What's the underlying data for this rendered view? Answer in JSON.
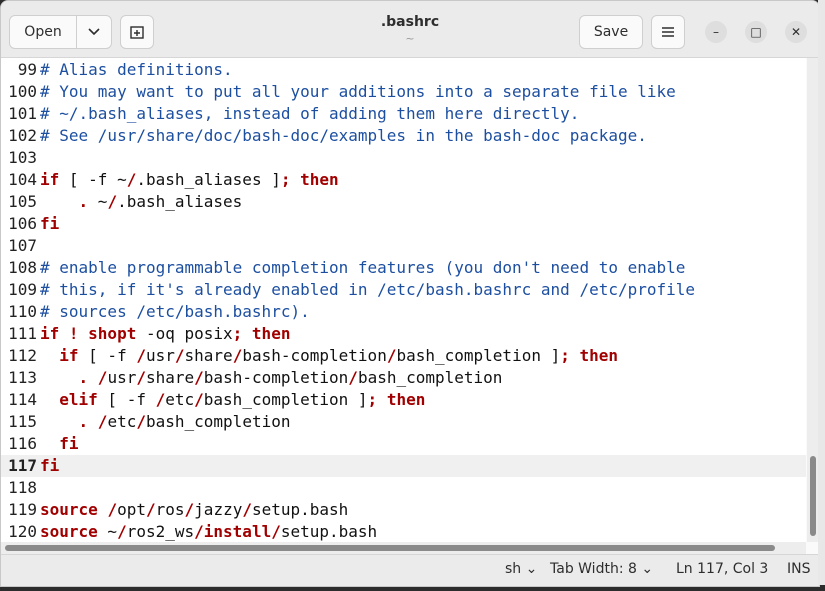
{
  "header": {
    "open_label": "Open",
    "open_menu_icon": "chevron-down-icon",
    "new_tab_icon": "new-tab-icon",
    "title": ".bashrc",
    "subtitle": "~",
    "save_label": "Save",
    "menu_icon": "hamburger-menu-icon"
  },
  "window_controls": {
    "minimize": "–",
    "maximize": "□",
    "close": "✕"
  },
  "editor": {
    "current_line": 117,
    "colors": {
      "comment": "#1d4fa0",
      "keyword": "#a10000",
      "text": "#111111"
    },
    "lines": [
      {
        "num": "99",
        "tokens": [
          {
            "t": "# Alias definitions.",
            "k": "comment"
          }
        ]
      },
      {
        "num": "100",
        "tokens": [
          {
            "t": "# You may want to put all your additions into a separate file like",
            "k": "comment"
          }
        ]
      },
      {
        "num": "101",
        "tokens": [
          {
            "t": "# ~/.bash_aliases, instead of adding them here directly.",
            "k": "comment"
          }
        ]
      },
      {
        "num": "102",
        "tokens": [
          {
            "t": "# See /usr/share/doc/bash-doc/examples in the bash-doc package.",
            "k": "comment"
          }
        ]
      },
      {
        "num": "103",
        "tokens": []
      },
      {
        "num": "104",
        "tokens": [
          {
            "t": "if",
            "k": "keyword"
          },
          {
            "t": " [ -f ~",
            "k": "plain"
          },
          {
            "t": "/",
            "k": "sep"
          },
          {
            "t": ".bash_aliases ]",
            "k": "plain"
          },
          {
            "t": "; then",
            "k": "keyword"
          }
        ]
      },
      {
        "num": "105",
        "tokens": [
          {
            "t": "    ",
            "k": "plain"
          },
          {
            "t": ".",
            "k": "keyword"
          },
          {
            "t": " ~",
            "k": "plain"
          },
          {
            "t": "/",
            "k": "sep"
          },
          {
            "t": ".bash_aliases",
            "k": "plain"
          }
        ]
      },
      {
        "num": "106",
        "tokens": [
          {
            "t": "fi",
            "k": "keyword"
          }
        ]
      },
      {
        "num": "107",
        "tokens": []
      },
      {
        "num": "108",
        "tokens": [
          {
            "t": "# enable programmable completion features (you don't need to enable",
            "k": "comment"
          }
        ]
      },
      {
        "num": "109",
        "tokens": [
          {
            "t": "# this, if it's already enabled in /etc/bash.bashrc and /etc/profile",
            "k": "comment"
          }
        ]
      },
      {
        "num": "110",
        "tokens": [
          {
            "t": "# sources /etc/bash.bashrc).",
            "k": "comment"
          }
        ]
      },
      {
        "num": "111",
        "tokens": [
          {
            "t": "if ! shopt",
            "k": "keyword"
          },
          {
            "t": " -oq posix",
            "k": "plain"
          },
          {
            "t": "; then",
            "k": "keyword"
          }
        ]
      },
      {
        "num": "112",
        "tokens": [
          {
            "t": "  ",
            "k": "plain"
          },
          {
            "t": "if",
            "k": "keyword"
          },
          {
            "t": " [ -f ",
            "k": "plain"
          },
          {
            "t": "/",
            "k": "sep"
          },
          {
            "t": "usr",
            "k": "plain"
          },
          {
            "t": "/",
            "k": "sep"
          },
          {
            "t": "share",
            "k": "plain"
          },
          {
            "t": "/",
            "k": "sep"
          },
          {
            "t": "bash-completion",
            "k": "plain"
          },
          {
            "t": "/",
            "k": "sep"
          },
          {
            "t": "bash_completion ]",
            "k": "plain"
          },
          {
            "t": "; then",
            "k": "keyword"
          }
        ]
      },
      {
        "num": "113",
        "tokens": [
          {
            "t": "    ",
            "k": "plain"
          },
          {
            "t": ". /",
            "k": "keyword"
          },
          {
            "t": "usr",
            "k": "plain"
          },
          {
            "t": "/",
            "k": "sep"
          },
          {
            "t": "share",
            "k": "plain"
          },
          {
            "t": "/",
            "k": "sep"
          },
          {
            "t": "bash-completion",
            "k": "plain"
          },
          {
            "t": "/",
            "k": "sep"
          },
          {
            "t": "bash_completion",
            "k": "plain"
          }
        ]
      },
      {
        "num": "114",
        "tokens": [
          {
            "t": "  ",
            "k": "plain"
          },
          {
            "t": "elif",
            "k": "keyword"
          },
          {
            "t": " [ -f ",
            "k": "plain"
          },
          {
            "t": "/",
            "k": "sep"
          },
          {
            "t": "etc",
            "k": "plain"
          },
          {
            "t": "/",
            "k": "sep"
          },
          {
            "t": "bash_completion ]",
            "k": "plain"
          },
          {
            "t": "; then",
            "k": "keyword"
          }
        ]
      },
      {
        "num": "115",
        "tokens": [
          {
            "t": "    ",
            "k": "plain"
          },
          {
            "t": ". /",
            "k": "keyword"
          },
          {
            "t": "etc",
            "k": "plain"
          },
          {
            "t": "/",
            "k": "sep"
          },
          {
            "t": "bash_completion",
            "k": "plain"
          }
        ]
      },
      {
        "num": "116",
        "tokens": [
          {
            "t": "  ",
            "k": "plain"
          },
          {
            "t": "fi",
            "k": "keyword"
          }
        ]
      },
      {
        "num": "117",
        "tokens": [
          {
            "t": "fi",
            "k": "keyword"
          }
        ]
      },
      {
        "num": "118",
        "tokens": []
      },
      {
        "num": "119",
        "tokens": [
          {
            "t": "source",
            "k": "keyword"
          },
          {
            "t": " ",
            "k": "plain"
          },
          {
            "t": "/",
            "k": "sep"
          },
          {
            "t": "opt",
            "k": "plain"
          },
          {
            "t": "/",
            "k": "sep"
          },
          {
            "t": "ros",
            "k": "plain"
          },
          {
            "t": "/",
            "k": "sep"
          },
          {
            "t": "jazzy",
            "k": "plain"
          },
          {
            "t": "/",
            "k": "sep"
          },
          {
            "t": "setup.bash",
            "k": "plain"
          }
        ]
      },
      {
        "num": "120",
        "tokens": [
          {
            "t": "source",
            "k": "keyword"
          },
          {
            "t": " ~",
            "k": "plain"
          },
          {
            "t": "/",
            "k": "sep"
          },
          {
            "t": "ros2_ws",
            "k": "plain"
          },
          {
            "t": "/install/",
            "k": "sep"
          },
          {
            "t": "setup.bash",
            "k": "plain"
          }
        ]
      }
    ]
  },
  "statusbar": {
    "language": "sh",
    "tab_width": "Tab Width: 8",
    "position": "Ln 117, Col 3",
    "mode": "INS"
  }
}
